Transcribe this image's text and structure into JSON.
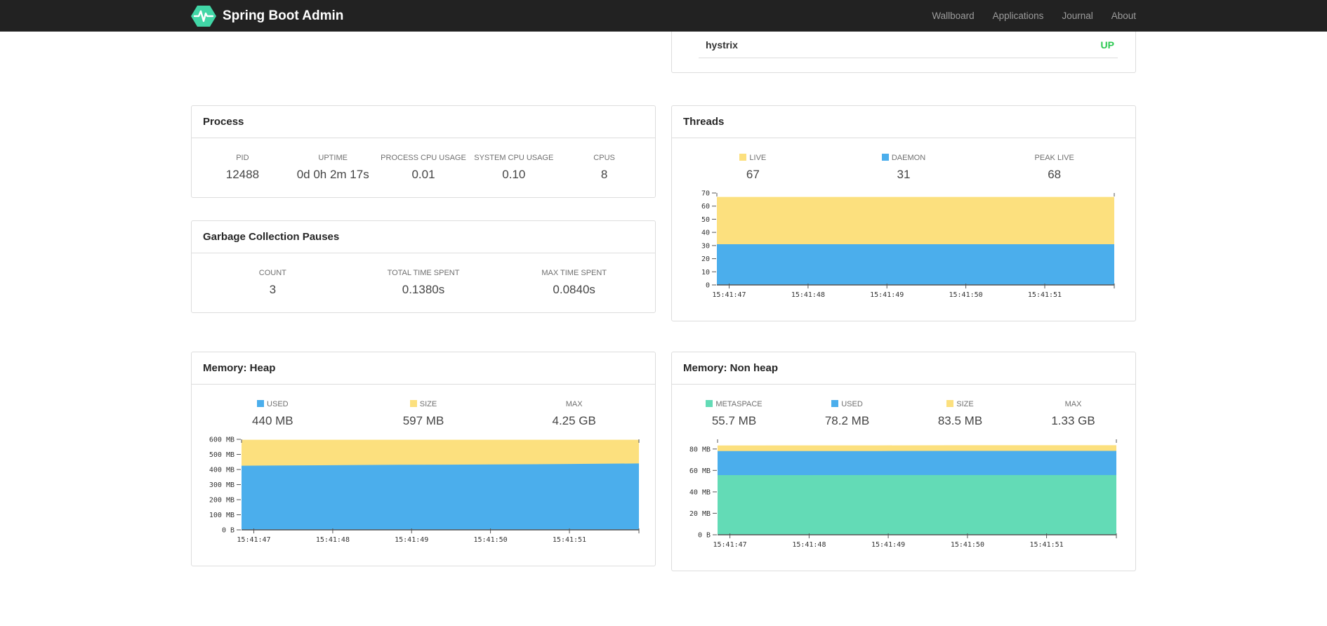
{
  "navbar": {
    "brand": "Spring Boot Admin",
    "brand_color": "#41d6a6",
    "items": [
      {
        "label": "Wallboard"
      },
      {
        "label": "Applications"
      },
      {
        "label": "Journal"
      },
      {
        "label": "About"
      }
    ]
  },
  "application_status": {
    "name": "hystrix",
    "status": "UP",
    "status_color": "#2bc850"
  },
  "cards": {
    "process": {
      "title": "Process",
      "stats": [
        {
          "label": "PID",
          "value": "12488"
        },
        {
          "label": "UPTIME",
          "value": "0d 0h 2m 17s"
        },
        {
          "label": "PROCESS CPU USAGE",
          "value": "0.01"
        },
        {
          "label": "SYSTEM CPU USAGE",
          "value": "0.10"
        },
        {
          "label": "CPUS",
          "value": "8"
        }
      ]
    },
    "gc": {
      "title": "Garbage Collection Pauses",
      "stats": [
        {
          "label": "COUNT",
          "value": "3"
        },
        {
          "label": "TOTAL TIME SPENT",
          "value": "0.1380s"
        },
        {
          "label": "MAX TIME SPENT",
          "value": "0.0840s"
        }
      ]
    },
    "threads": {
      "title": "Threads",
      "stats": [
        {
          "label": "LIVE",
          "value": "67",
          "swatch": "#fce07e"
        },
        {
          "label": "DAEMON",
          "value": "31",
          "swatch": "#4baeec"
        },
        {
          "label": "PEAK LIVE",
          "value": "68"
        }
      ]
    },
    "heap": {
      "title": "Memory: Heap",
      "stats": [
        {
          "label": "USED",
          "value": "440 MB",
          "swatch": "#4baeec"
        },
        {
          "label": "SIZE",
          "value": "597 MB",
          "swatch": "#fce07e"
        },
        {
          "label": "MAX",
          "value": "4.25 GB"
        }
      ]
    },
    "nonheap": {
      "title": "Memory: Non heap",
      "stats": [
        {
          "label": "METASPACE",
          "value": "55.7 MB",
          "swatch": "#63dbb6"
        },
        {
          "label": "USED",
          "value": "78.2 MB",
          "swatch": "#4baeec"
        },
        {
          "label": "SIZE",
          "value": "83.5 MB",
          "swatch": "#fce07e"
        },
        {
          "label": "MAX",
          "value": "1.33 GB"
        }
      ]
    }
  },
  "chart_data": [
    {
      "id": "threads-chart",
      "type": "area",
      "mode": "overlay",
      "title": "Threads",
      "x_ticks": [
        "15:41:47",
        "15:41:48",
        "15:41:49",
        "15:41:50",
        "15:41:51"
      ],
      "ylim": [
        0,
        70
      ],
      "y_ticks": [
        {
          "v": 0,
          "label": "0"
        },
        {
          "v": 10,
          "label": "10"
        },
        {
          "v": 20,
          "label": "20"
        },
        {
          "v": 30,
          "label": "30"
        },
        {
          "v": 40,
          "label": "40"
        },
        {
          "v": 50,
          "label": "50"
        },
        {
          "v": 60,
          "label": "60"
        },
        {
          "v": 70,
          "label": "70"
        }
      ],
      "series": [
        {
          "name": "LIVE",
          "color": "#fce07e",
          "points": [
            67,
            67,
            67,
            67,
            67,
            67
          ]
        },
        {
          "name": "DAEMON",
          "color": "#4baeec",
          "points": [
            31,
            31,
            31,
            31,
            31,
            31
          ]
        }
      ]
    },
    {
      "id": "heap-chart",
      "type": "area",
      "mode": "overlay",
      "title": "Memory: Heap",
      "x_ticks": [
        "15:41:47",
        "15:41:48",
        "15:41:49",
        "15:41:50",
        "15:41:51"
      ],
      "ylim": [
        0,
        600
      ],
      "y_ticks": [
        {
          "v": 0,
          "label": "0 B"
        },
        {
          "v": 100,
          "label": "100 MB"
        },
        {
          "v": 200,
          "label": "200 MB"
        },
        {
          "v": 300,
          "label": "300 MB"
        },
        {
          "v": 400,
          "label": "400 MB"
        },
        {
          "v": 500,
          "label": "500 MB"
        },
        {
          "v": 600,
          "label": "600 MB"
        }
      ],
      "series": [
        {
          "name": "SIZE",
          "color": "#fce07e",
          "points": [
            597,
            597,
            597,
            597,
            597,
            597
          ]
        },
        {
          "name": "USED",
          "color": "#4baeec",
          "points": [
            425,
            428,
            431,
            433,
            436,
            440
          ]
        }
      ]
    },
    {
      "id": "nonheap-chart",
      "type": "area",
      "mode": "overlay",
      "title": "Memory: Non heap",
      "x_ticks": [
        "15:41:47",
        "15:41:48",
        "15:41:49",
        "15:41:50",
        "15:41:51"
      ],
      "ylim": [
        0,
        89
      ],
      "y_ticks": [
        {
          "v": 0,
          "label": "0 B"
        },
        {
          "v": 20,
          "label": "20 MB"
        },
        {
          "v": 40,
          "label": "40 MB"
        },
        {
          "v": 60,
          "label": "60 MB"
        },
        {
          "v": 80,
          "label": "80 MB"
        }
      ],
      "series": [
        {
          "name": "SIZE",
          "color": "#fce07e",
          "points": [
            83.3,
            83.4,
            83.4,
            83.5,
            83.5,
            83.5
          ]
        },
        {
          "name": "USED",
          "color": "#4baeec",
          "points": [
            78.0,
            78.0,
            78.1,
            78.2,
            78.2,
            78.2
          ]
        },
        {
          "name": "METASPACE",
          "color": "#63dbb6",
          "points": [
            55.6,
            55.6,
            55.7,
            55.7,
            55.7,
            55.7
          ]
        }
      ]
    }
  ]
}
